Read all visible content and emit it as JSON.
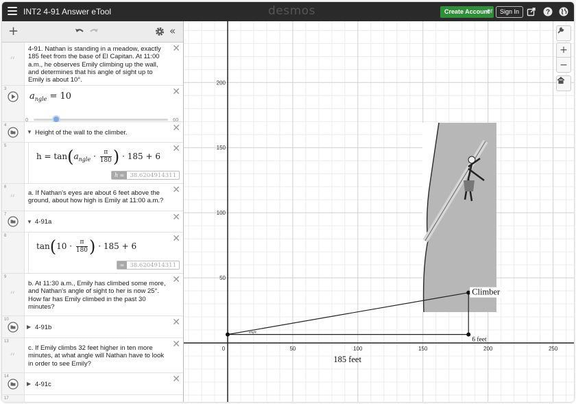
{
  "topbar": {
    "doc_title": "INT2 4-91 Answer eTool",
    "brand": "desmos",
    "create_account": "Create Account",
    "or": "or",
    "sign_in": "Sign In"
  },
  "rows": {
    "r1": {
      "text": "4-91. Nathan is standing in a meadow, exactly 185 feet from the base of El Capitan.  At 11:00 a.m., he observes Emily climbing up the wall, and determines that his angle of sight up to Emily is about 10°."
    },
    "r3": {
      "num": "3",
      "var": "a",
      "sub": "ngle",
      "value": "= 10",
      "slider_min": "0",
      "slider_max": "60",
      "slider_value": 10
    },
    "r4": {
      "num": "4",
      "label": "Height of the wall to the climber."
    },
    "r5": {
      "num": "5",
      "lhs": "h = tan",
      "a": "a",
      "sub": "ngle",
      "dot": "·",
      "pi": "π",
      "den": "180",
      "tail": "· 185 + 6",
      "result_label": "h =",
      "result_value": "38.6204914311"
    },
    "r6": {
      "num": "6",
      "text": "a. If Nathan's eyes are about 6 feet above the ground, about how high is Emily at 11:00 a.m.?"
    },
    "r7": {
      "num": "7",
      "label": "4-91a"
    },
    "r8": {
      "num": "8",
      "lhs": "tan",
      "ten": "10",
      "dot": "·",
      "pi": "π",
      "den": "180",
      "tail": "· 185 + 6",
      "result_label": "=",
      "result_value": "38.6204914311"
    },
    "r9": {
      "num": "9",
      "text": "b. At 11:30 a.m., Emily has climbed some more, and Nathan's angle of sight to her is now 25°.  How far has Emily climbed in the past 30 minutes?"
    },
    "r10": {
      "num": "10",
      "label": "4-91b"
    },
    "r13": {
      "num": "13",
      "text": "c. If Emily climbs 32 feet higher in ten more minutes, at what angle will Nathan have to look in order to see Emily?"
    },
    "r14": {
      "num": "14",
      "label": "4-91c"
    },
    "r17": {
      "num": "17"
    }
  },
  "graph": {
    "x_ticks": [
      "0",
      "50",
      "100",
      "150",
      "200",
      "250"
    ],
    "y_ticks": [
      "50",
      "100",
      "150",
      "200"
    ],
    "climber_label": "Climber",
    "six_feet_label": "6 feet",
    "distance_label": "185 feet",
    "angle_label": "angle",
    "triangle": {
      "base_x": [
        0,
        185
      ],
      "eye_y": 6,
      "climber_y": 38.62
    }
  },
  "icons": {
    "menu": "hamburger-icon",
    "share": "share-icon",
    "help": "help-icon",
    "language": "globe-icon",
    "add": "plus-icon",
    "undo": "undo-icon",
    "redo": "redo-icon",
    "settings": "gear-icon",
    "collapse": "double-chevron-left-icon",
    "wrench": "wrench-icon",
    "zoom_in": "zoom-in-icon",
    "zoom_out": "zoom-out-icon",
    "home": "home-icon"
  },
  "colors": {
    "create_account_bg": "#2f8f39",
    "slider_thumb": "#7fa7e0",
    "topbar_bg": "#2a2a2a"
  }
}
